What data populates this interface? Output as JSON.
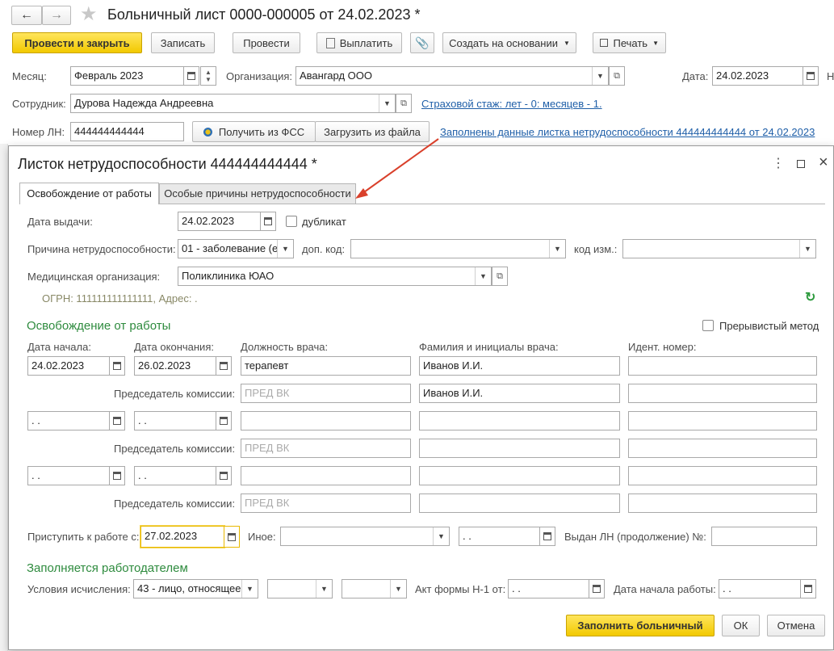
{
  "toolbar": {
    "back_icon": "arrow-left-icon",
    "forward_icon": "arrow-right-icon",
    "star_icon": "star-icon",
    "title": "Больничный лист 0000-000005 от 24.02.2023 *",
    "post_close": "Провести и закрыть",
    "save": "Записать",
    "post": "Провести",
    "pay": "Выплатить",
    "attach_icon": "paperclip-icon",
    "create_based": "Создать на основании",
    "print": "Печать"
  },
  "header": {
    "month_label": "Месяц:",
    "month_value": "Февраль 2023",
    "org_label": "Организация:",
    "org_value": "Авангард ООО",
    "date_label": "Дата:",
    "date_value": "24.02.2023",
    "date_tail": "Н",
    "employee_label": "Сотрудник:",
    "employee_value": "Дурова Надежда Андреевна",
    "insurance_link": "Страховой стаж: лет - 0: месяцев - 1.",
    "ln_label": "Номер ЛН:",
    "ln_value": "444444444444",
    "get_fss": "Получить из ФСС",
    "load_file": "Загрузить из файла",
    "filled_link": "Заполнены данные листка нетрудоспособности 444444444444 от 24.02.2023"
  },
  "dialog": {
    "title": "Листок нетрудоспособности 444444444444 *",
    "tabs": [
      "Освобождение от работы",
      "Особые причины нетрудоспособности"
    ],
    "issue_date_label": "Дата выдачи:",
    "issue_date_value": "24.02.2023",
    "duplicate_label": "дубликат",
    "reason_label": "Причина нетрудоспособности:",
    "reason_value": "01 - заболевание (е",
    "extra_code_label": "доп. код:",
    "change_code_label": "код изм.:",
    "med_org_label": "Медицинская организация:",
    "med_org_value": "Поликлиника ЮАО",
    "ogrn_text": "ОГРН: 111111111111111, Адрес: .",
    "release_section": "Освобождение от работы",
    "intermittent_label": "Прерывистый метод",
    "col_start": "Дата начала:",
    "col_end": "Дата окончания:",
    "col_position": "Должность врача:",
    "col_doctor": "Фамилия и инициалы врача:",
    "col_id": "Идент.  номер:",
    "rows": [
      {
        "start": "24.02.2023",
        "end": "26.02.2023",
        "position": "терапевт",
        "doctor": "Иванов И.И.",
        "chair_label": "Председатель комиссии:",
        "chair_placeholder": "ПРЕД ВК",
        "chair_doctor": "Иванов И.И."
      },
      {
        "start": " .  .",
        "end": " .  .",
        "position": "",
        "doctor": "",
        "chair_label": "Председатель комиссии:",
        "chair_placeholder": "ПРЕД ВК",
        "chair_doctor": ""
      },
      {
        "start": " .  .",
        "end": " .  .",
        "position": "",
        "doctor": "",
        "chair_label": "Председатель комиссии:",
        "chair_placeholder": "ПРЕД ВК",
        "chair_doctor": ""
      }
    ],
    "return_label": "Приступить к работе с:",
    "return_value": "27.02.2023",
    "other_label": "Иное:",
    "other_date": " .  .",
    "continuation_label": "Выдан ЛН (продолжение) №:",
    "employer_section": "Заполняется работодателем",
    "conditions_label": "Условия исчисления:",
    "conditions_value": "43 - лицо, относящее",
    "act_label": "Акт формы Н-1 от:",
    "act_value": " .  .",
    "work_start_label": "Дата начала работы:",
    "work_start_value": " .  .",
    "fill_button": "Заполнить больничный",
    "ok_button": "ОК",
    "cancel_button": "Отмена"
  },
  "colors": {
    "accent_yellow": "#f5cf1a",
    "section_green": "#2e8b3e",
    "link_blue": "#1f5fa8",
    "arrow_red": "#d9402b"
  }
}
